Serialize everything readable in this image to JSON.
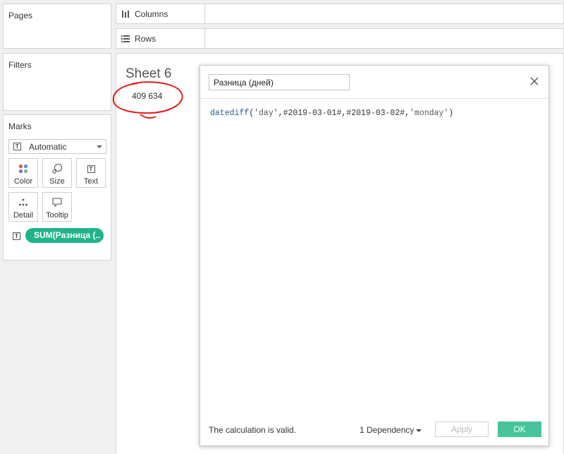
{
  "left": {
    "pages_title": "Pages",
    "filters_title": "Filters",
    "marks_title": "Marks",
    "mark_type": "Automatic",
    "mark_buttons": [
      {
        "label": "Color"
      },
      {
        "label": "Size"
      },
      {
        "label": "Text"
      },
      {
        "label": "Detail"
      },
      {
        "label": "Tooltip"
      }
    ],
    "pill_label": "SUM(Разница (.."
  },
  "shelves": {
    "columns_label": "Columns",
    "rows_label": "Rows"
  },
  "sheet": {
    "title": "Sheet 6",
    "value": "409 634"
  },
  "dialog": {
    "name_value": "Разница (дней)",
    "formula": {
      "fn": "datediff",
      "open": "(",
      "arg1": "'day'",
      "comma1": ",",
      "arg2": "#2019-03-01#",
      "comma2": ",",
      "arg3": "#2019-03-02#",
      "comma3": ",",
      "arg4": "'monday'",
      "close": ")"
    },
    "status": "The calculation is valid.",
    "dependency_label": "1 Dependency",
    "apply_label": "Apply",
    "ok_label": "OK"
  },
  "colors": {
    "pill": "#1fb48a",
    "ok_button": "#46c59a",
    "function": "#1d5d99",
    "annotation": "#e0201b"
  },
  "icons": [
    "columns-icon",
    "rows-icon",
    "automatic-text-icon",
    "color-icon",
    "size-icon",
    "text-icon",
    "detail-icon",
    "tooltip-icon",
    "close-icon"
  ]
}
